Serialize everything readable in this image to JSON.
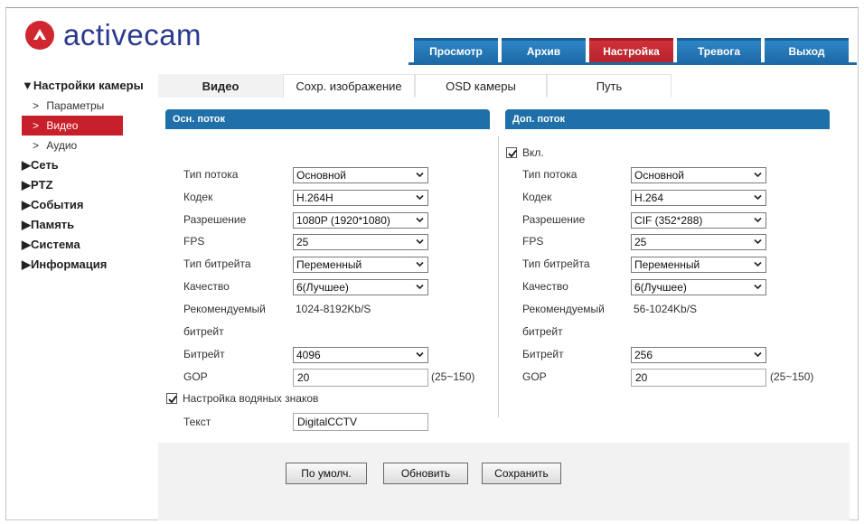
{
  "brand": {
    "name": "activecam",
    "logo_color": "#d0262f",
    "text_color": "#2b3a8c"
  },
  "topnav": [
    {
      "label": "Просмотр",
      "active": false
    },
    {
      "label": "Архив",
      "active": false
    },
    {
      "label": "Настройка",
      "active": true
    },
    {
      "label": "Тревога",
      "active": false
    },
    {
      "label": "Выход",
      "active": false
    }
  ],
  "sidebar": {
    "camera_settings": "▼Настройки камеры",
    "sub": [
      {
        "chev": ">",
        "label": "Параметры"
      },
      {
        "chev": ">",
        "label": "Видео",
        "active": true
      },
      {
        "chev": ">",
        "label": "Аудио"
      }
    ],
    "groups": [
      "▶Сеть",
      "▶PTZ",
      "▶События",
      "▶Память",
      "▶Система",
      "▶Информация"
    ]
  },
  "tabs": [
    "Видео",
    "Сохр. изображение",
    "OSD камеры",
    "Путь"
  ],
  "main_stream": {
    "header": "Осн. поток",
    "stream_type_label": "Тип потока",
    "stream_type": "Основной",
    "codec_label": "Кодек",
    "codec": "H.264H",
    "resolution_label": "Разрешение",
    "resolution": "1080P (1920*1080)",
    "fps_label": "FPS",
    "fps": "25",
    "bitrate_type_label": "Тип битрейта",
    "bitrate_type": "Переменный",
    "quality_label": "Качество",
    "quality": "6(Лучшее)",
    "recommended_label_1": "Рекомендуемый",
    "recommended_label_2": "битрейт",
    "recommended_value": "1024-8192Kb/S",
    "bitrate_label": "Битрейт",
    "bitrate": "4096",
    "gop_label": "GOP",
    "gop": "20",
    "gop_range": "(25~150)",
    "watermark_label": "Настройка водяных знаков",
    "watermark_checked": true,
    "text_label": "Текст",
    "text_value": "DigitalCCTV"
  },
  "sub_stream": {
    "header": "Доп. поток",
    "enable_label": "Вкл.",
    "enabled": true,
    "stream_type_label": "Тип потока",
    "stream_type": "Основной",
    "codec_label": "Кодек",
    "codec": "H.264",
    "resolution_label": "Разрешение",
    "resolution": "CIF (352*288)",
    "fps_label": "FPS",
    "fps": "25",
    "bitrate_type_label": "Тип битрейта",
    "bitrate_type": "Переменный",
    "quality_label": "Качество",
    "quality": "6(Лучшее)",
    "recommended_label_1": "Рекомендуемый",
    "recommended_label_2": "битрейт",
    "recommended_value": "56-1024Kb/S",
    "bitrate_label": "Битрейт",
    "bitrate": "256",
    "gop_label": "GOP",
    "gop": "20",
    "gop_range": "(25~150)"
  },
  "buttons": {
    "default": "По умолч.",
    "refresh": "Обновить",
    "save": "Сохранить"
  },
  "colors": {
    "nav_blue": "#1d6aa6",
    "nav_red": "#c8202a",
    "section_blue": "#1f6fa8"
  }
}
